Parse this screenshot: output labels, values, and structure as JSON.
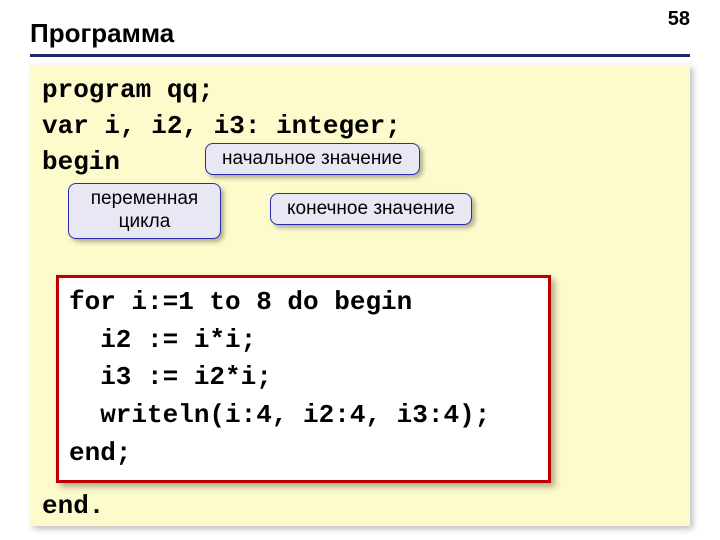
{
  "page_number": "58",
  "title": "Программа",
  "code": {
    "line1": "program qq;",
    "line2": "var i, i2, i3: integer;",
    "line3": "begin",
    "line_end": "end."
  },
  "inner_code": {
    "l1": "for i:=1 to 8 do begin",
    "l2": "  i2 := i*i;",
    "l3": "  i3 := i2*i;",
    "l4": "  writeln(i:4, i2:4, i3:4);",
    "l5": "end;"
  },
  "callouts": {
    "initial_value": "начальное значение",
    "loop_variable": "переменная цикла",
    "final_value": "конечное значение"
  }
}
